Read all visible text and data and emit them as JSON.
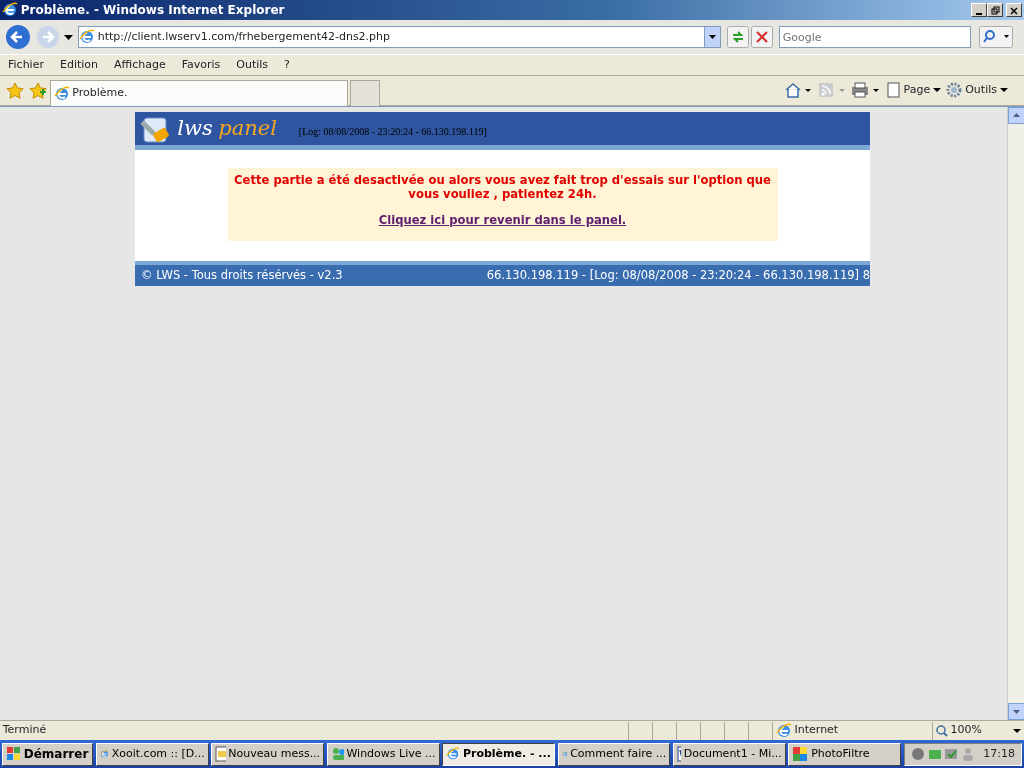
{
  "window": {
    "title": "Problème. - Windows Internet Explorer"
  },
  "address_bar": {
    "url": "http://client.lwserv1.com/frhebergement42-dns2.php",
    "search_placeholder": "Google"
  },
  "menu": [
    "Fichier",
    "Edition",
    "Affichage",
    "Favoris",
    "Outils",
    "?"
  ],
  "tabs": [
    {
      "label": "Problème.",
      "selected": true
    }
  ],
  "command_bar": [
    "Page",
    "Outils"
  ],
  "page": {
    "logo_word_1": "lws",
    "logo_word_2": "panel",
    "log": "[Log: 08/08/2008 - 23:20:24 - 66.130.198.119]",
    "message": "Cette partie a été desactivée ou alors vous avez fait trop d'essais sur l'option que vous vouliez , patientez 24h.",
    "link": "Cliquez ici pour revenir dans le panel.",
    "footer_left": "© LWS - Tous droits résérvés - v2.3",
    "footer_right": "66.130.198.119 - [Log: 08/08/2008 - 23:20:24 - 66.130.198.119] 8"
  },
  "status_bar": {
    "text": "Terminé",
    "zone": "Internet",
    "zoom": "100%"
  },
  "taskbar": {
    "start": "Démarrer",
    "clock": "17:18",
    "items": [
      {
        "label": "Xooit.com :: [D...",
        "kind": "browser",
        "selected": false
      },
      {
        "label": "Nouveau mess...",
        "kind": "mail",
        "selected": false
      },
      {
        "label": "Windows Live ...",
        "kind": "messenger",
        "selected": false
      },
      {
        "label": "Problème. - ...",
        "kind": "browser",
        "selected": true
      },
      {
        "label": "Comment faire ...",
        "kind": "browser",
        "selected": false
      },
      {
        "label": "Document1 - Mi...",
        "kind": "word",
        "selected": false
      },
      {
        "label": "PhotoFiltre",
        "kind": "paint",
        "selected": false
      }
    ]
  }
}
